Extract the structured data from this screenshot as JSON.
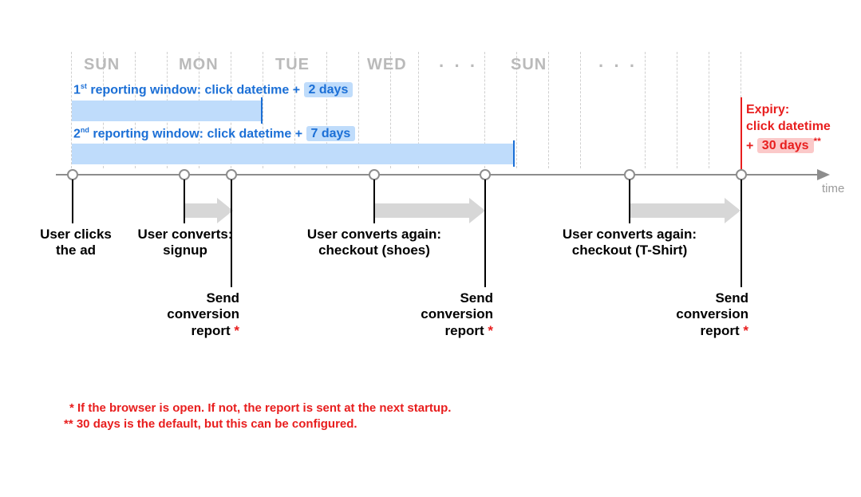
{
  "days": {
    "d0": "SUN",
    "d1": "MON",
    "d2": "TUE",
    "d3": "WED",
    "dots1": "· · ·",
    "d7": "SUN",
    "dots2": "· · ·"
  },
  "window1": {
    "prefix": "1",
    "ord": "st",
    "text": " reporting window: click datetime + ",
    "value": "2 days"
  },
  "window2": {
    "prefix": "2",
    "ord": "nd",
    "text": " reporting window: click datetime + ",
    "value": "7 days"
  },
  "expiry": {
    "line1": "Expiry:",
    "line2": "click datetime",
    "plus": "+ ",
    "value": "30 days",
    "stars": "**"
  },
  "axis": {
    "label": "time"
  },
  "events": {
    "click": {
      "l1": "User clicks",
      "l2": "the ad"
    },
    "signup": {
      "l1": "User converts:",
      "l2": "signup"
    },
    "shoes": {
      "l1": "User converts again:",
      "l2": "checkout (shoes)"
    },
    "tshirt": {
      "l1": "User converts again:",
      "l2": "checkout (T-Shirt)"
    }
  },
  "report": {
    "l1": "Send",
    "l2": "conversion",
    "l3": "report ",
    "star": "*"
  },
  "footnotes": {
    "f1_stars": " * ",
    "f1": "If the browser is open. If not, the report is sent at the next startup.",
    "f2_stars": "** ",
    "f2": "30 days is the default, but this can be configured."
  }
}
